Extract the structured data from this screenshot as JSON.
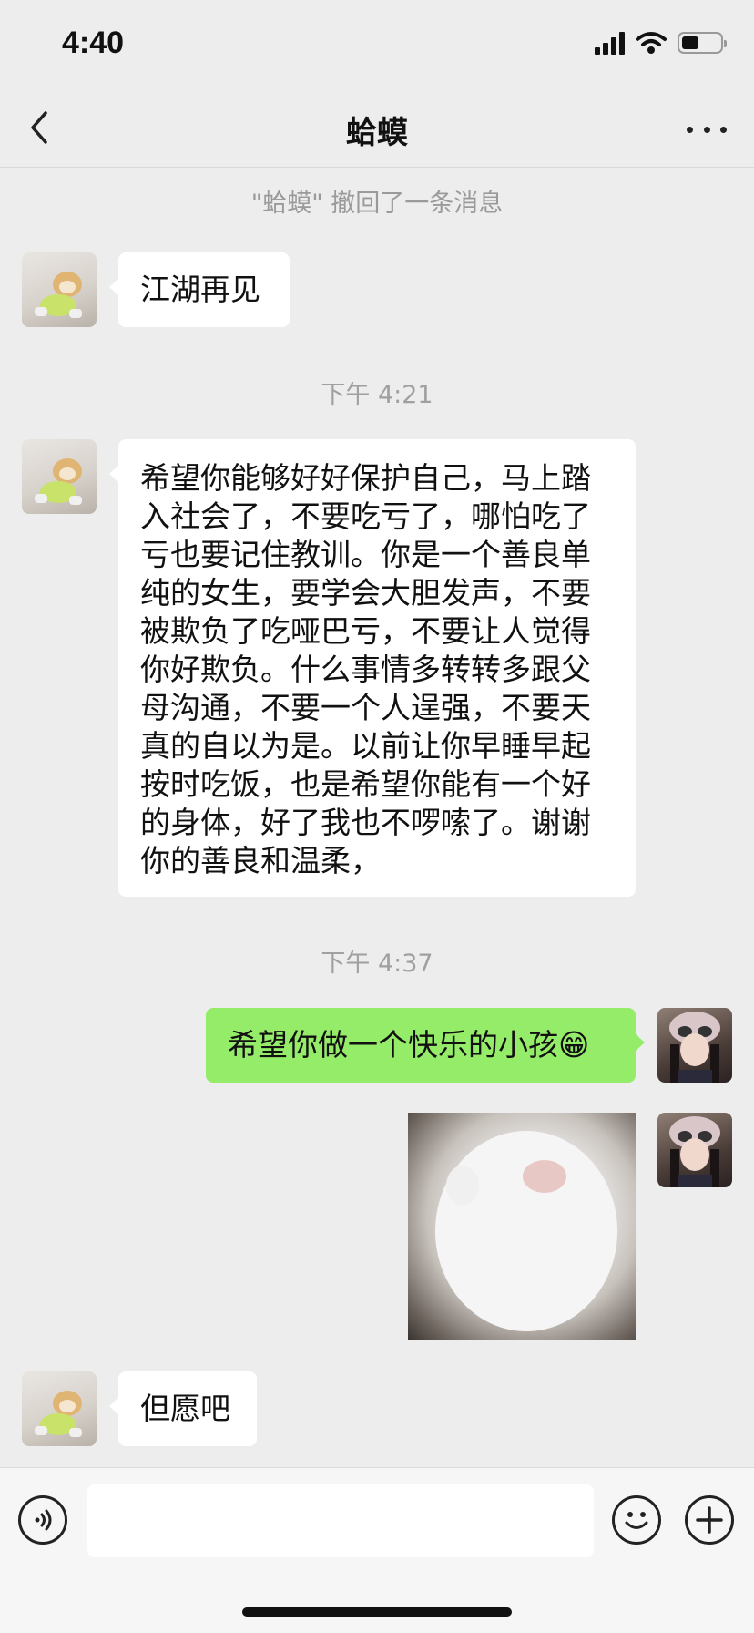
{
  "status_bar": {
    "time": "4:40",
    "battery_level": 0.45,
    "icons": [
      "signal-icon",
      "wifi-icon",
      "battery-icon"
    ]
  },
  "nav": {
    "title": "蛤蟆",
    "icons": [
      "back-chevron-icon",
      "more-dots-icon"
    ]
  },
  "chat": {
    "system_notice": "\"蛤蟆\" 撤回了一条消息",
    "messages": [
      {
        "from": "other",
        "text": "江湖再见"
      },
      {
        "from": "timestamp",
        "text": "下午 4:21"
      },
      {
        "from": "other",
        "text": "希望你能够好好保护自己，马上踏入社会了，不要吃亏了，哪怕吃了亏也要记住教训。你是一个善良单纯的女生，要学会大胆发声，不要被欺负了吃哑巴亏，不要让人觉得你好欺负。什么事情多转转多跟父母沟通，不要一个人逞强，不要天真的自以为是。以前让你早睡早起按时吃饭，也是希望你能有一个好的身体，好了我也不啰嗦了。谢谢你的善良和温柔，"
      },
      {
        "from": "timestamp",
        "text": "下午 4:37"
      },
      {
        "from": "me",
        "text": "希望你做一个快乐的小孩😁"
      },
      {
        "from": "me",
        "type": "image",
        "image": "white-cat-photo"
      },
      {
        "from": "other",
        "text": "但愿吧"
      }
    ]
  },
  "input_bar": {
    "icons": [
      "voice-icon",
      "emoji-icon",
      "plus-icon"
    ]
  },
  "colors": {
    "background": "#ededed",
    "my_bubble": "#95ec69",
    "other_bubble": "#ffffff"
  }
}
